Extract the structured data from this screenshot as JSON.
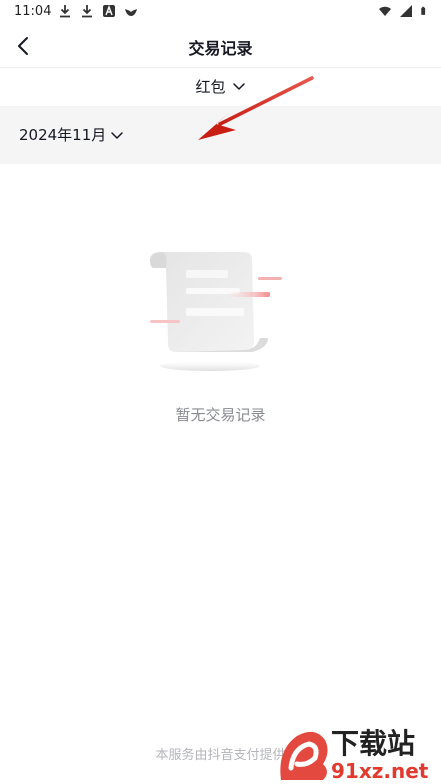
{
  "status_bar": {
    "time": "11:04",
    "left_icons": [
      "download-icon",
      "download-icon",
      "text-badge-icon",
      "bird-icon"
    ],
    "right_icons": [
      "wifi-icon",
      "signal-icon",
      "battery-icon"
    ]
  },
  "header": {
    "title": "交易记录",
    "back_icon": "chevron-left-icon"
  },
  "filter": {
    "label": "红包",
    "icon": "chevron-down-icon"
  },
  "month": {
    "label": "2024年11月",
    "icon": "chevron-down-icon"
  },
  "empty_state": {
    "message": "暂无交易记录",
    "icon": "scroll-icon"
  },
  "footer": {
    "text": "本服务由抖音支付提供"
  },
  "watermark": {
    "brand_text": "下载站",
    "domain_text": "91xz.net"
  },
  "colors": {
    "background": "#ffffff",
    "month_bar": "#f5f5f5",
    "primary_text": "#161823",
    "secondary_text": "#8a8b91",
    "annotation_arrow": "#d9261c"
  }
}
